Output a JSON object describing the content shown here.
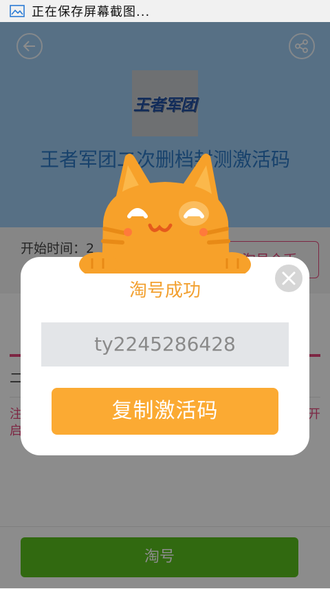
{
  "statusbar": {
    "icon": "gallery-icon",
    "text": "正在保存屏幕截图..."
  },
  "header": {
    "back_icon": "back-arrow-icon",
    "share_icon": "share-icon",
    "logo_text": "王者军团",
    "title": "王者军团二次删档封测激活码"
  },
  "info": {
    "start_label": "开始时间：2",
    "claim_button": "淘号个币"
  },
  "tabs": {
    "section_title": "二",
    "notice_left": "注",
    "notice_left2": "启",
    "notice_right": "开"
  },
  "modal": {
    "title": "淘号成功",
    "code": "ty2245286428",
    "copy_button": "复制激活码",
    "close_icon": "close-icon",
    "mascot": "cat-mascot"
  },
  "bottom": {
    "primary_button": "淘号"
  },
  "colors": {
    "header_bg": "#9fcdf3",
    "title_blue": "#2c78c5",
    "accent_pink": "#e4467a",
    "orange": "#fbaa33",
    "green": "#5ac01e"
  }
}
